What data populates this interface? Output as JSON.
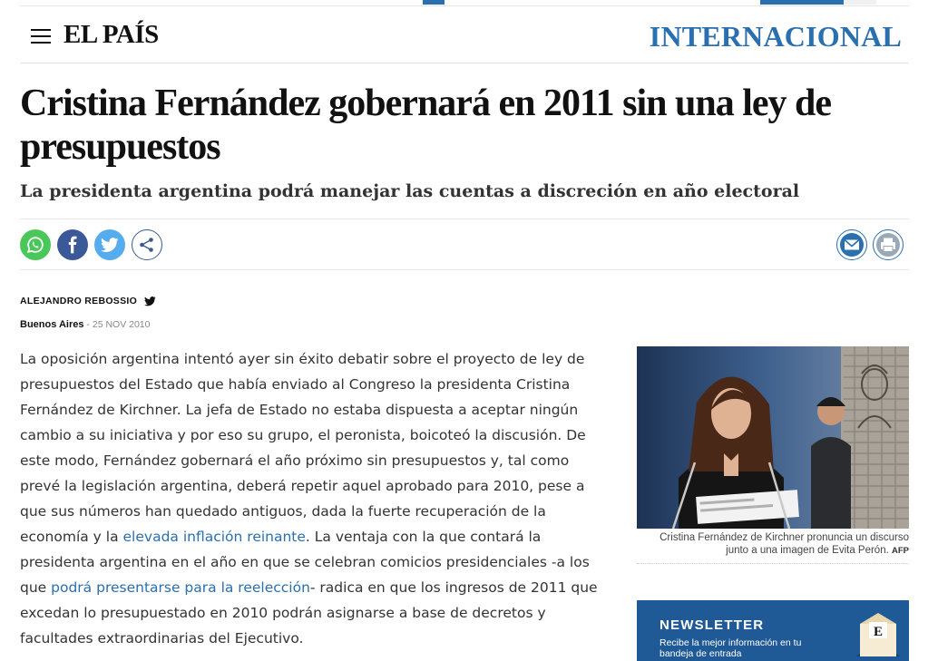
{
  "header": {
    "menu_label": "Menu",
    "logo": "EL PAÍS",
    "section": "INTERNACIONAL"
  },
  "article": {
    "headline": "Cristina Fernández gobernará en 2011 sin una ley de presupuestos",
    "subtitle": "La presidenta argentina podrá manejar las cuentas a discreción en año electoral",
    "author": "ALEJANDRO REBOSSIO",
    "place": "Buenos Aires",
    "date_separator": " - ",
    "date": "25 NOV 2010",
    "body": {
      "part1": "La oposición argentina intentó ayer sin éxito debatir sobre el proyecto de ley de presupuestos del Estado que había enviado al Congreso la presidenta Cristina Fernández de Kirchner. La jefa de Estado no estaba dispuesta a aceptar ningún cambio a su iniciativa y por eso su grupo, el peronista, boicoteó la discusión. De este modo, Fernández gobernará el año próximo sin presupuestos y, tal como prevé la legislación argentina, deberá repetir aquel aprobado para 2010, pese a que sus números han quedado antiguos, dada la fuerte recuperación de la economía y la ",
      "link1": "elevada inflación reinante",
      "part2": ". La ventaja con la que contará la presidenta argentina en el año en que se celebran comicios presidenciales -a los que ",
      "link2": "podrá presentarse para la reelección",
      "part3": "- radica en que los ingresos de 2011 que excedan lo presupuestado en 2010 podrán asignarse a base de decretos y facultades extraordinarias del Ejecutivo."
    }
  },
  "share": {
    "icons": [
      "whatsapp-icon",
      "facebook-icon",
      "twitter-icon",
      "share-icon",
      "mail-icon",
      "print-icon"
    ]
  },
  "photo": {
    "caption": "Cristina Fernández de Kirchner pronuncia un discurso junto a una imagen de Evita Perón.",
    "agency": "AFP"
  },
  "newsletter": {
    "title": "NEWSLETTER",
    "description": "Recibe la mejor información en tu bandeja de entrada"
  },
  "colors": {
    "accent": "#2a6fb0",
    "newsletter_bg": "#1f5a96",
    "whatsapp": "#49c759",
    "facebook": "#3b5998",
    "twitter": "#55acee"
  }
}
